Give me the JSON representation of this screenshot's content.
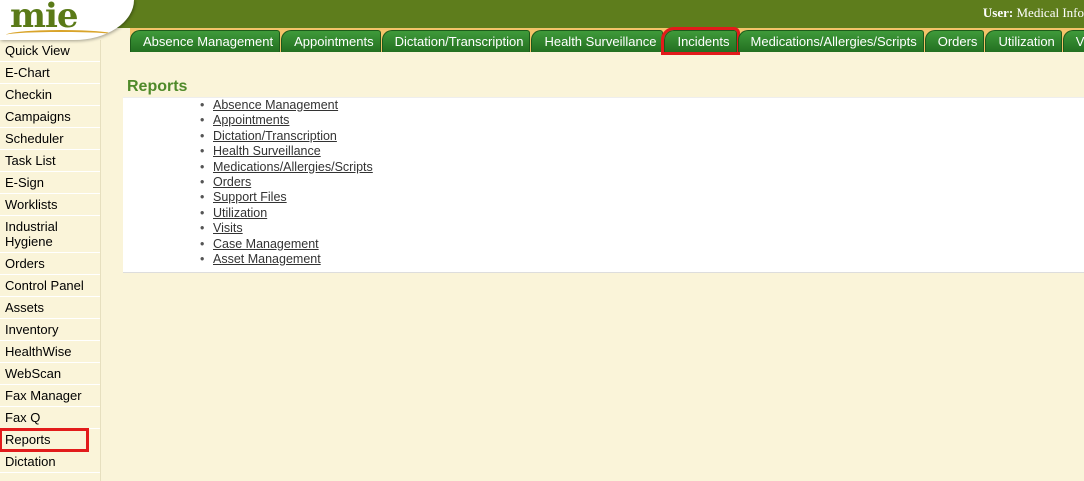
{
  "header": {
    "logo_text": "mie",
    "user_label": "User:",
    "user_value": "Medical Info"
  },
  "tabs": [
    {
      "label": "Absence Management"
    },
    {
      "label": "Appointments"
    },
    {
      "label": "Dictation/Transcription"
    },
    {
      "label": "Health Surveillance"
    },
    {
      "label": "Incidents",
      "highlighted": true
    },
    {
      "label": "Medications/Allergies/Scripts"
    },
    {
      "label": "Orders"
    },
    {
      "label": "Utilization"
    },
    {
      "label": "Visits"
    }
  ],
  "sidebar": {
    "items": [
      {
        "label": "Quick View"
      },
      {
        "label": "E-Chart"
      },
      {
        "label": "Checkin"
      },
      {
        "label": "Campaigns"
      },
      {
        "label": "Scheduler"
      },
      {
        "label": "Task List"
      },
      {
        "label": "E-Sign"
      },
      {
        "label": "Worklists"
      },
      {
        "label": "Industrial Hygiene"
      },
      {
        "label": "Orders"
      },
      {
        "label": "Control Panel"
      },
      {
        "label": "Assets"
      },
      {
        "label": "Inventory"
      },
      {
        "label": "HealthWise"
      },
      {
        "label": "WebScan"
      },
      {
        "label": "Fax Manager"
      },
      {
        "label": "Fax Q"
      },
      {
        "label": "Reports",
        "highlighted": true
      },
      {
        "label": "Dictation"
      }
    ]
  },
  "main": {
    "title": "Reports",
    "bullet": "•",
    "links": [
      "Absence Management",
      "Appointments",
      "Dictation/Transcription",
      "Health Surveillance",
      "Medications/Allergies/Scripts",
      "Orders",
      "Support Files",
      "Utilization",
      "Visits",
      "Case Management",
      "Asset Management"
    ]
  },
  "colors": {
    "topbar": "#5e7d1c",
    "tab_green": "#237021",
    "tab_strip": "#f4c46a",
    "background": "#faf4d9",
    "highlight": "#e21b1b",
    "title_green": "#4f8a2a"
  }
}
